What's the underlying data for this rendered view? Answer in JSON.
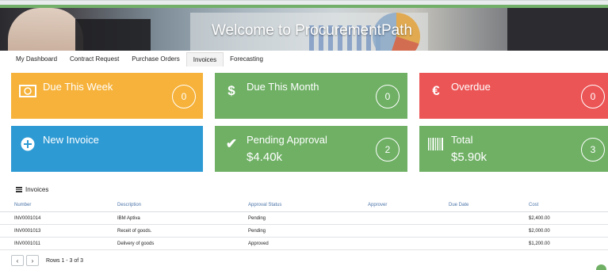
{
  "header": {
    "title": "Welcome to ProcurementPath",
    "accent_color": "#72b06a"
  },
  "tabs": [
    {
      "label": "My Dashboard",
      "active": false
    },
    {
      "label": "Contract Request",
      "active": false
    },
    {
      "label": "Purchase Orders",
      "active": false
    },
    {
      "label": "Invoices",
      "active": true
    },
    {
      "label": "Forecasting",
      "active": false
    }
  ],
  "cards": {
    "due_week": {
      "label": "Due This Week",
      "count": "0",
      "icon": "banknote-icon",
      "color": "#f6b23a"
    },
    "due_month": {
      "label": "Due This Month",
      "count": "0",
      "icon": "dollar-icon",
      "glyph": "$",
      "color": "#6fb065"
    },
    "overdue": {
      "label": "Overdue",
      "count": "0",
      "icon": "euro-icon",
      "glyph": "€",
      "color": "#ec5556"
    },
    "new_invoice": {
      "label": "New Invoice",
      "icon": "plus-circle-icon",
      "color": "#2e9ad4"
    },
    "pending": {
      "label": "Pending Approval",
      "value": "$4.40k",
      "count": "2",
      "icon": "checkmark-icon",
      "glyph": "✔",
      "color": "#6fb065"
    },
    "total": {
      "label": "Total",
      "value": "$5.90k",
      "count": "3",
      "icon": "barcode-icon",
      "color": "#6fb065"
    }
  },
  "invoices": {
    "title": "Invoices",
    "columns": [
      "Number",
      "Description",
      "Approval Status",
      "Approver",
      "Due Date",
      "Cost"
    ],
    "rows": [
      {
        "number": "INV0001014",
        "description": "IBM Aptiva",
        "status": "Pending",
        "approver": "",
        "due_date": "",
        "cost": "$2,400.00"
      },
      {
        "number": "INV0001013",
        "description": "Receit of goods.",
        "status": "Pending",
        "approver": "",
        "due_date": "",
        "cost": "$2,000.00"
      },
      {
        "number": "INV0001011",
        "description": "Delivery of goods",
        "status": "Approved",
        "approver": "",
        "due_date": "",
        "cost": "$1,200.00"
      }
    ],
    "pager": {
      "prev": "‹",
      "next": "›",
      "label": "Rows 1 - 3 of 3"
    }
  }
}
